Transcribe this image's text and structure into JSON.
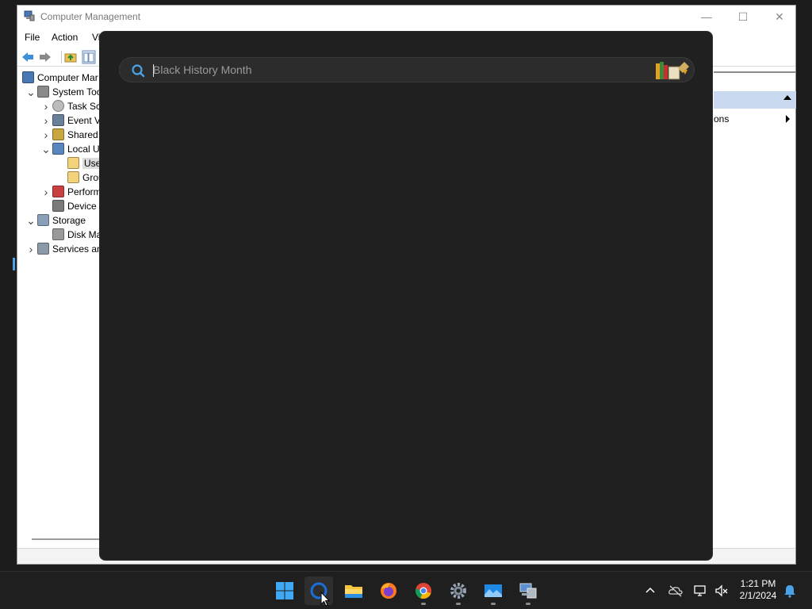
{
  "window": {
    "title": "Computer Management",
    "controls": {
      "minimize": "—",
      "maximize": "☐",
      "close": "✕"
    }
  },
  "menu": [
    "File",
    "Action",
    "Vi"
  ],
  "tree": [
    {
      "label": "Computer Mar",
      "icon": "computer-management-icon",
      "level": 0,
      "toggle": ""
    },
    {
      "label": "System Too",
      "icon": "tools-icon",
      "level": 1,
      "toggle": "v"
    },
    {
      "label": "Task Sc",
      "icon": "clock-icon",
      "level": 2,
      "toggle": ">"
    },
    {
      "label": "Event V",
      "icon": "event-viewer-icon",
      "level": 2,
      "toggle": ">"
    },
    {
      "label": "Shared",
      "icon": "shared-folder-icon",
      "level": 2,
      "toggle": ">"
    },
    {
      "label": "Local U",
      "icon": "users-icon",
      "level": 2,
      "toggle": "v"
    },
    {
      "label": "Use",
      "icon": "folder-icon",
      "level": 3,
      "toggle": "",
      "selected": true
    },
    {
      "label": "Grou",
      "icon": "folder-icon",
      "level": 3,
      "toggle": ""
    },
    {
      "label": "Perform",
      "icon": "performance-icon",
      "level": 2,
      "toggle": ">"
    },
    {
      "label": "Device",
      "icon": "device-manager-icon",
      "level": 2,
      "toggle": ""
    },
    {
      "label": "Storage",
      "icon": "storage-icon",
      "level": 1,
      "toggle": "v"
    },
    {
      "label": "Disk Ma",
      "icon": "disk-icon",
      "level": 2,
      "toggle": ""
    },
    {
      "label": "Services an",
      "icon": "services-icon",
      "level": 1,
      "toggle": ">"
    }
  ],
  "actions": {
    "item_label": "ons"
  },
  "search": {
    "placeholder": "Black History Month"
  },
  "taskbar": {
    "apps": [
      "start-icon",
      "search-icon",
      "file-explorer-icon",
      "firefox-icon",
      "chrome-icon",
      "settings-icon",
      "photos-icon",
      "remote-desktop-icon"
    ]
  },
  "clock": {
    "time": "1:21 PM",
    "date": "2/1/2024"
  },
  "colors": {
    "accent": "#0078d4",
    "panel": "#202020",
    "taskbar": "#1f1f1f"
  }
}
